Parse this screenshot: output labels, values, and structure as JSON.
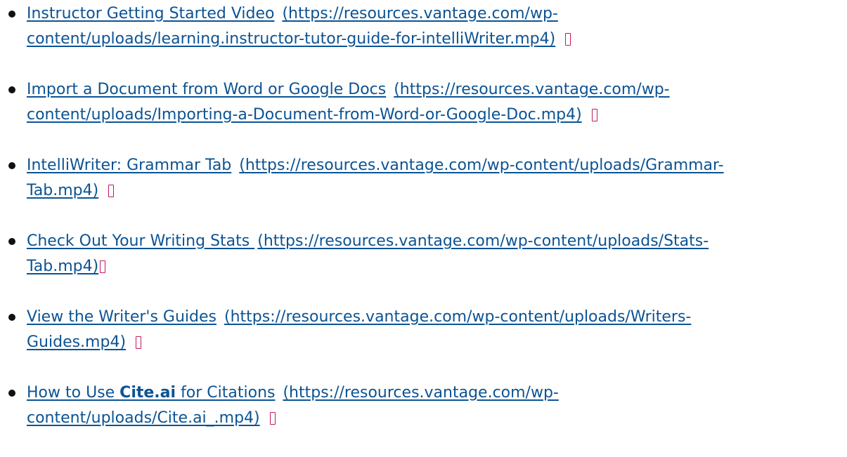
{
  "videos": [
    {
      "title": "Instructor Getting Started Video",
      "url_line1": "(https://resources.vantage.com/wp-",
      "url_line2": "content/uploads/learning.instructor-tutor-guide-for-intelliWriter.mp4)"
    },
    {
      "title": "Import a Document from Word or Google Docs",
      "url_line1": "(https://resources.vantage.com/wp-",
      "url_line2": "content/uploads/Importing-a-Document-from-Word-or-Google-Doc.mp4)"
    },
    {
      "title": "IntelliWriter: Grammar Tab",
      "url_line1": "(https://resources.vantage.com/wp-content/uploads/Grammar-",
      "url_line2": "Tab.mp4)"
    },
    {
      "title": "Check Out Your Writing Stats ",
      "url_line1": "(https://resources.vantage.com/wp-content/uploads/Stats-",
      "url_line2": "Tab.mp4)"
    },
    {
      "title": "View the Writer's Guides",
      "url_line1": "(https://resources.vantage.com/wp-content/uploads/Writers-",
      "url_line2": "Guides.mp4)"
    },
    {
      "title_prefix": "How to Use ",
      "title_bold": "Cite.ai",
      "title_suffix": " for Citations",
      "url_line1": "(https://resources.vantage.com/wp-",
      "url_line2": "content/uploads/Cite.ai_.mp4)"
    }
  ],
  "icon_name": "new-window-icon",
  "colors": {
    "link": "#0b5394",
    "icon": "#c2185b",
    "text": "#111111"
  }
}
